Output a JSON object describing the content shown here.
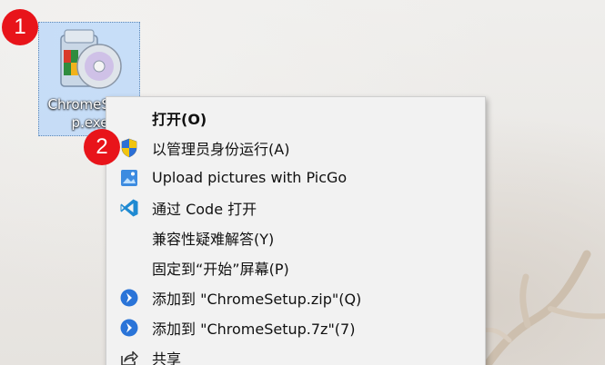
{
  "desktop": {
    "icon": {
      "label": "ChromeSetu\np.exe",
      "icon_name": "installer-package-icon"
    }
  },
  "badges": [
    {
      "number": "1"
    },
    {
      "number": "2"
    }
  ],
  "context_menu": {
    "items": [
      {
        "label": "打开(O)",
        "icon": null,
        "bold": true
      },
      {
        "label": "以管理员身份运行(A)",
        "icon": "uac-shield-icon",
        "bold": false
      },
      {
        "label": "Upload pictures with PicGo",
        "icon": "picgo-icon",
        "bold": false
      },
      {
        "label": "通过 Code 打开",
        "icon": "vscode-icon",
        "bold": false
      },
      {
        "label": "兼容性疑难解答(Y)",
        "icon": null,
        "bold": false
      },
      {
        "label": "固定到“开始”屏幕(P)",
        "icon": null,
        "bold": false
      },
      {
        "label": "添加到 \"ChromeSetup.zip\"(Q)",
        "icon": "bandizip-icon",
        "bold": false
      },
      {
        "label": "添加到 \"ChromeSetup.7z\"(7)",
        "icon": "bandizip-icon",
        "bold": false
      },
      {
        "label": "共享",
        "icon": "share-icon",
        "bold": false
      }
    ]
  },
  "colors": {
    "badge": "#e8141a",
    "menu_background": "#f2f2f2",
    "selection": "#a4cdff"
  }
}
